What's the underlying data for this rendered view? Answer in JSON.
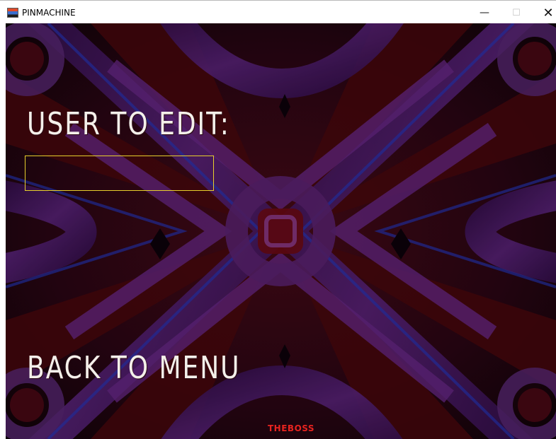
{
  "window": {
    "title": "PINMACHINE",
    "minimize_symbol": "—",
    "maximize_symbol": "☐",
    "close_symbol": "✕"
  },
  "game": {
    "heading": "USER TO EDIT:",
    "input_value": "",
    "back_label": "BACK TO MENU",
    "footer_name": "THEBOSS"
  },
  "colors": {
    "background": "#150308",
    "pattern_purple": "#3b1650",
    "pattern_dark_red": "#3a0508",
    "input_border": "#e7cf2c",
    "footer_text": "#e8231f",
    "menu_text": "#f4f0ea"
  },
  "icons": {
    "app": "pinmachine-app-icon",
    "minimize": "minimize-icon",
    "maximize": "maximize-icon",
    "close": "close-icon"
  }
}
